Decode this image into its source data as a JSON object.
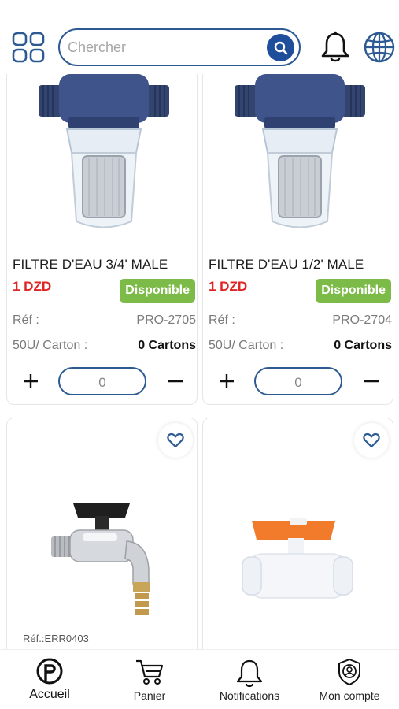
{
  "header": {
    "search_placeholder": "Chercher",
    "icons": [
      "grid-icon",
      "search-icon",
      "bell-icon",
      "globe-icon"
    ]
  },
  "products": [
    {
      "name": "FILTRE D'EAU 3/4' MALE",
      "price": "1 DZD",
      "availability": "Disponible",
      "ref_label": "Réf :",
      "ref": "PRO-2705",
      "carton_label": "50U/ Carton :",
      "carton_value": "0 Cartons",
      "quantity": "0"
    },
    {
      "name": "FILTRE D'EAU 1/2' MALE",
      "price": "1 DZD",
      "availability": "Disponible",
      "ref_label": "Réf :",
      "ref": "PRO-2704",
      "carton_label": "50U/ Carton :",
      "carton_value": "0 Cartons",
      "quantity": "0"
    },
    {
      "ref_text": "Réf.:ERR0403"
    },
    {}
  ],
  "bottom_nav": {
    "items": [
      {
        "label": "Accueil",
        "icon": "home-logo-icon",
        "active": true
      },
      {
        "label": "Panier",
        "icon": "cart-icon",
        "active": false
      },
      {
        "label": "Notifications",
        "icon": "bell-icon",
        "active": false
      },
      {
        "label": "Mon compte",
        "icon": "account-icon",
        "active": false
      }
    ]
  },
  "colors": {
    "brand_blue": "#2d5a93",
    "search_button": "#1f4f9a",
    "price_red": "#e02424",
    "available_green": "#7dbb48"
  }
}
